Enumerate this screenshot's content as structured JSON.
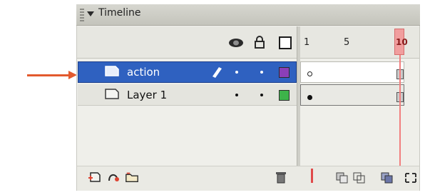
{
  "panel": {
    "title": "Timeline",
    "header": {
      "eye_icon": "eye-icon",
      "lock_icon": "lock-icon",
      "outline_icon": "outline-icon"
    },
    "frame_ruler": {
      "labels": [
        "1",
        "5",
        "10"
      ],
      "current_frame": "10"
    },
    "layers": [
      {
        "name": "action",
        "selected": true,
        "visible_dot": "•",
        "lock_dot": "•",
        "outline_color": "#8b3fb8"
      },
      {
        "name": "Layer 1",
        "selected": false,
        "visible_dot": "•",
        "lock_dot": "•",
        "outline_color": "#3db34a"
      }
    ],
    "bottom_toolbar": {
      "insert_layer_icon": "insert-layer-icon",
      "add_motion_guide_icon": "add-motion-guide-icon",
      "insert_folder_icon": "insert-folder-icon",
      "delete_icon": "trash-icon",
      "center_frame_icon": "center-frame-icon",
      "onion_skin_icon": "onion-skin-icon",
      "onion_outlines_icon": "onion-outlines-icon",
      "edit_multiple_frames_icon": "edit-multiple-frames-icon",
      "modify_onion_markers_icon": "modify-onion-markers-icon"
    }
  },
  "colors": {
    "selection": "#2f61c0",
    "arrow": "#e35a2e",
    "playhead": "#f19e9e"
  }
}
